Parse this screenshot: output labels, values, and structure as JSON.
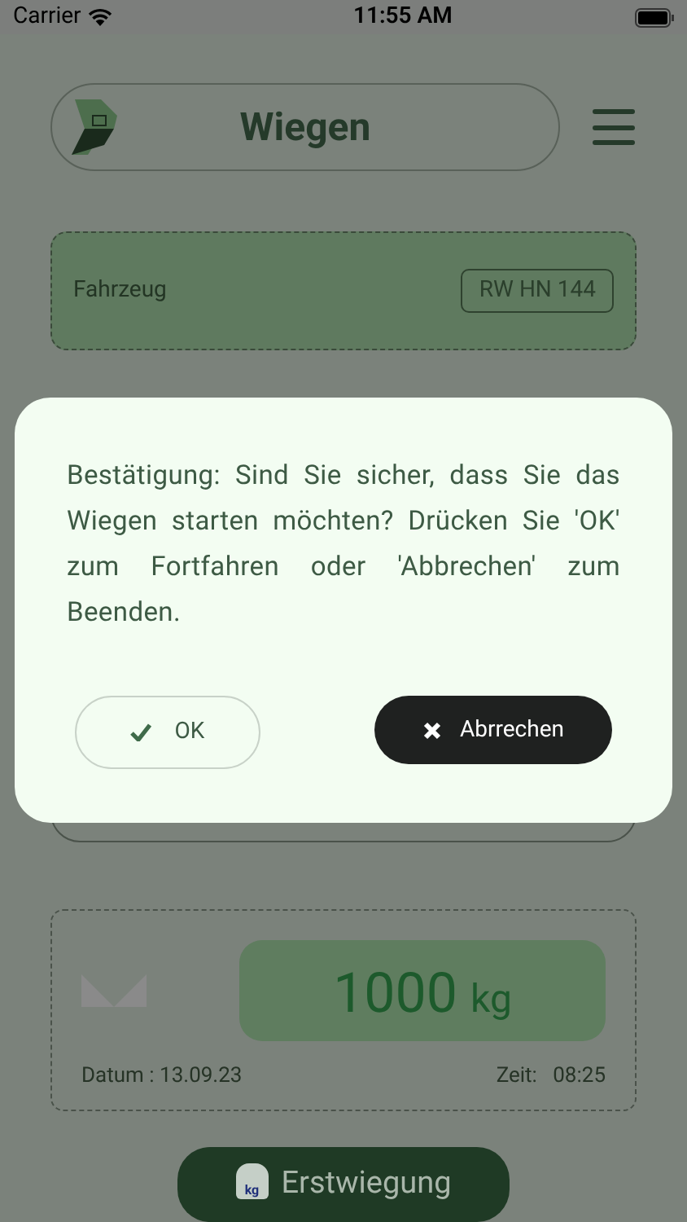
{
  "status_bar": {
    "carrier": "Carrier",
    "time": "11:55 AM"
  },
  "header": {
    "title": "Wiegen"
  },
  "vehicle": {
    "label": "Fahrzeug",
    "plate": "RW HN 144"
  },
  "weight": {
    "value": "1000",
    "unit": "kg",
    "date_label": "Datum :",
    "date": "13.09.23",
    "time_label": "Zeit:",
    "time": "08:25"
  },
  "action_button": {
    "label": "Erstwiegung",
    "badge": "kg"
  },
  "dialog": {
    "message": "Bestätigung: Sind Sie sicher, dass Sie das Wiegen starten möchten? Drücken Sie 'OK' zum Fortfahren oder 'Abbrechen' zum Beenden.",
    "buttons": [
      {
        "label": "OK",
        "kind": "confirm"
      },
      {
        "label": "Abrrechen",
        "kind": "cancel"
      }
    ]
  }
}
